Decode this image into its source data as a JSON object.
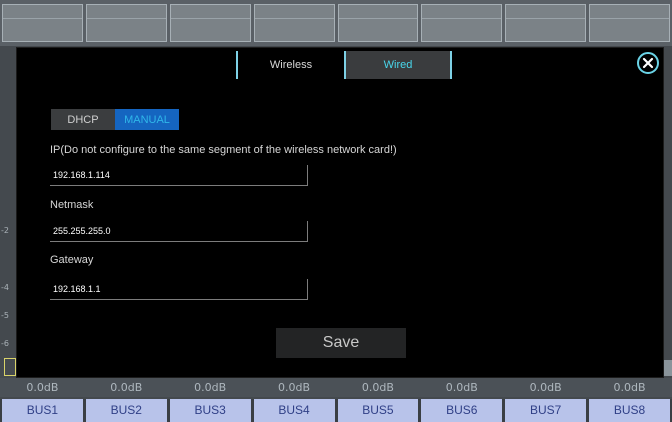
{
  "background": {
    "side_ticks": [
      "-2",
      "-4",
      "-5",
      "-6"
    ],
    "db_values": [
      "0.0dB",
      "0.0dB",
      "0.0dB",
      "0.0dB",
      "0.0dB",
      "0.0dB",
      "0.0dB",
      "0.0dB"
    ],
    "buses": [
      "BUS1",
      "BUS2",
      "BUS3",
      "BUS4",
      "BUS5",
      "BUS6",
      "BUS7",
      "BUS8"
    ]
  },
  "modal": {
    "tabs": [
      {
        "label": "Wireless",
        "active": false
      },
      {
        "label": "Wired",
        "active": true
      }
    ],
    "close_icon": "close-circle-icon",
    "mode": {
      "options": [
        "DHCP",
        "MANUAL"
      ],
      "selected": "MANUAL"
    },
    "fields": {
      "ip": {
        "label": "IP(Do not configure to the same segment of the wireless network card!)",
        "value": "192.168.1.114"
      },
      "netmask": {
        "label": "Netmask",
        "value": "255.255.255.0"
      },
      "gateway": {
        "label": "Gateway",
        "value": "192.168.1.1"
      }
    },
    "save_label": "Save"
  },
  "colors": {
    "accent": "#49d7ec",
    "manual_bg": "#1565c0",
    "bus_bg": "#b8c3ea",
    "bus_text": "#2f3f86"
  }
}
